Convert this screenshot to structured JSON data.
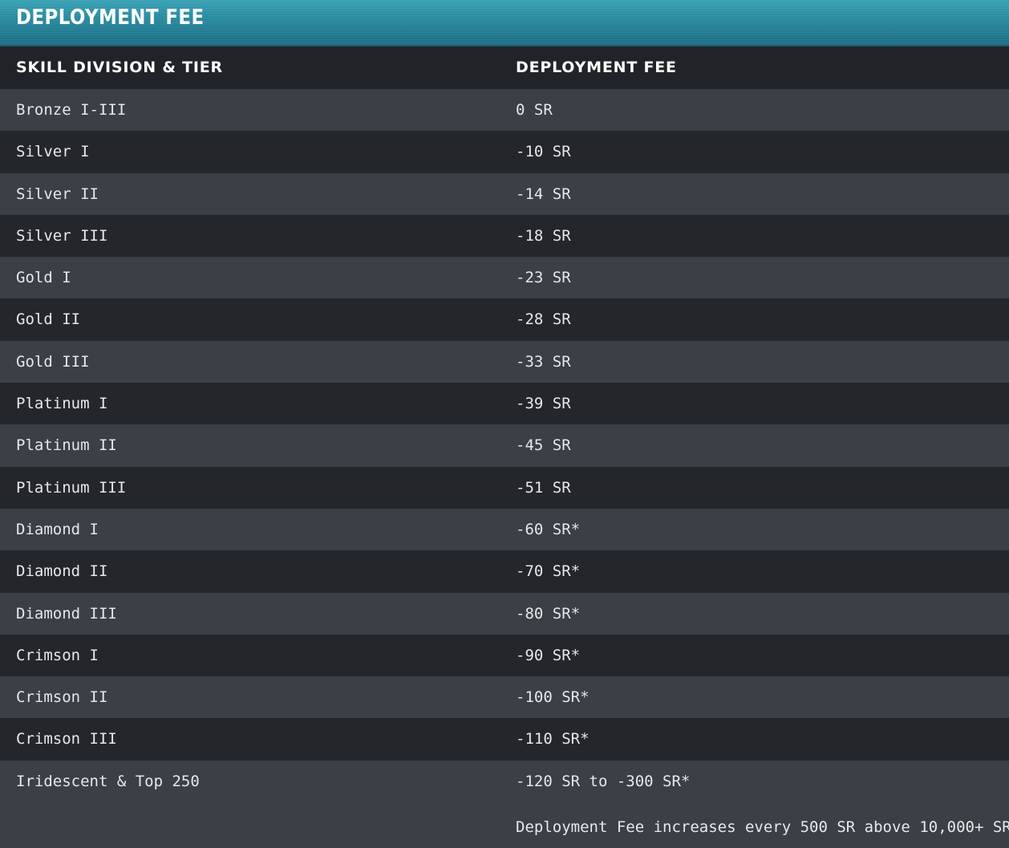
{
  "header": {
    "title": "DEPLOYMENT FEE"
  },
  "columns": [
    "SKILL DIVISION & TIER",
    "DEPLOYMENT FEE"
  ],
  "rows": [
    {
      "tier": "Bronze I-III",
      "fee": "0 SR"
    },
    {
      "tier": "Silver I",
      "fee": "-10 SR"
    },
    {
      "tier": "Silver II",
      "fee": "-14 SR"
    },
    {
      "tier": "Silver III",
      "fee": "-18 SR"
    },
    {
      "tier": "Gold I",
      "fee": "-23 SR"
    },
    {
      "tier": "Gold II",
      "fee": "-28 SR"
    },
    {
      "tier": "Gold III",
      "fee": "-33 SR"
    },
    {
      "tier": "Platinum I",
      "fee": "-39 SR"
    },
    {
      "tier": "Platinum II",
      "fee": "-45 SR"
    },
    {
      "tier": "Platinum III",
      "fee": "-51 SR"
    },
    {
      "tier": "Diamond I",
      "fee": "-60 SR*"
    },
    {
      "tier": "Diamond II",
      "fee": "-70 SR*"
    },
    {
      "tier": "Diamond III",
      "fee": "-80 SR*"
    },
    {
      "tier": "Crimson I",
      "fee": "-90 SR*"
    },
    {
      "tier": "Crimson II",
      "fee": "-100 SR*"
    },
    {
      "tier": "Crimson III",
      "fee": "-110 SR*"
    },
    {
      "tier": "Iridescent & Top 250",
      "fee": "-120 SR to -300 SR*"
    }
  ],
  "footnote": "Deployment Fee increases every 500 SR above 10,000+ SR.*",
  "colors": {
    "header_teal": "#2a8ba0",
    "row_dark": "#23272c",
    "row_light": "#3b3f46",
    "text": "#e6e8ea"
  }
}
